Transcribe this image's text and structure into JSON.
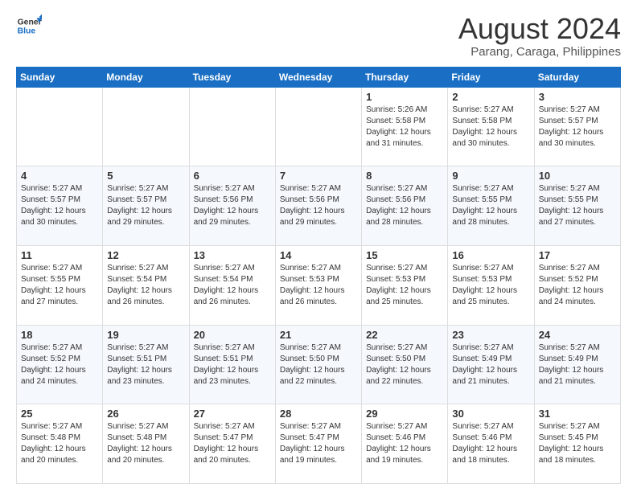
{
  "header": {
    "logo_line1": "General",
    "logo_line2": "Blue",
    "month": "August 2024",
    "location": "Parang, Caraga, Philippines"
  },
  "days_of_week": [
    "Sunday",
    "Monday",
    "Tuesday",
    "Wednesday",
    "Thursday",
    "Friday",
    "Saturday"
  ],
  "weeks": [
    [
      {
        "day": "",
        "text": ""
      },
      {
        "day": "",
        "text": ""
      },
      {
        "day": "",
        "text": ""
      },
      {
        "day": "",
        "text": ""
      },
      {
        "day": "1",
        "text": "Sunrise: 5:26 AM\nSunset: 5:58 PM\nDaylight: 12 hours\nand 31 minutes."
      },
      {
        "day": "2",
        "text": "Sunrise: 5:27 AM\nSunset: 5:58 PM\nDaylight: 12 hours\nand 30 minutes."
      },
      {
        "day": "3",
        "text": "Sunrise: 5:27 AM\nSunset: 5:57 PM\nDaylight: 12 hours\nand 30 minutes."
      }
    ],
    [
      {
        "day": "4",
        "text": "Sunrise: 5:27 AM\nSunset: 5:57 PM\nDaylight: 12 hours\nand 30 minutes."
      },
      {
        "day": "5",
        "text": "Sunrise: 5:27 AM\nSunset: 5:57 PM\nDaylight: 12 hours\nand 29 minutes."
      },
      {
        "day": "6",
        "text": "Sunrise: 5:27 AM\nSunset: 5:56 PM\nDaylight: 12 hours\nand 29 minutes."
      },
      {
        "day": "7",
        "text": "Sunrise: 5:27 AM\nSunset: 5:56 PM\nDaylight: 12 hours\nand 29 minutes."
      },
      {
        "day": "8",
        "text": "Sunrise: 5:27 AM\nSunset: 5:56 PM\nDaylight: 12 hours\nand 28 minutes."
      },
      {
        "day": "9",
        "text": "Sunrise: 5:27 AM\nSunset: 5:55 PM\nDaylight: 12 hours\nand 28 minutes."
      },
      {
        "day": "10",
        "text": "Sunrise: 5:27 AM\nSunset: 5:55 PM\nDaylight: 12 hours\nand 27 minutes."
      }
    ],
    [
      {
        "day": "11",
        "text": "Sunrise: 5:27 AM\nSunset: 5:55 PM\nDaylight: 12 hours\nand 27 minutes."
      },
      {
        "day": "12",
        "text": "Sunrise: 5:27 AM\nSunset: 5:54 PM\nDaylight: 12 hours\nand 26 minutes."
      },
      {
        "day": "13",
        "text": "Sunrise: 5:27 AM\nSunset: 5:54 PM\nDaylight: 12 hours\nand 26 minutes."
      },
      {
        "day": "14",
        "text": "Sunrise: 5:27 AM\nSunset: 5:53 PM\nDaylight: 12 hours\nand 26 minutes."
      },
      {
        "day": "15",
        "text": "Sunrise: 5:27 AM\nSunset: 5:53 PM\nDaylight: 12 hours\nand 25 minutes."
      },
      {
        "day": "16",
        "text": "Sunrise: 5:27 AM\nSunset: 5:53 PM\nDaylight: 12 hours\nand 25 minutes."
      },
      {
        "day": "17",
        "text": "Sunrise: 5:27 AM\nSunset: 5:52 PM\nDaylight: 12 hours\nand 24 minutes."
      }
    ],
    [
      {
        "day": "18",
        "text": "Sunrise: 5:27 AM\nSunset: 5:52 PM\nDaylight: 12 hours\nand 24 minutes."
      },
      {
        "day": "19",
        "text": "Sunrise: 5:27 AM\nSunset: 5:51 PM\nDaylight: 12 hours\nand 23 minutes."
      },
      {
        "day": "20",
        "text": "Sunrise: 5:27 AM\nSunset: 5:51 PM\nDaylight: 12 hours\nand 23 minutes."
      },
      {
        "day": "21",
        "text": "Sunrise: 5:27 AM\nSunset: 5:50 PM\nDaylight: 12 hours\nand 22 minutes."
      },
      {
        "day": "22",
        "text": "Sunrise: 5:27 AM\nSunset: 5:50 PM\nDaylight: 12 hours\nand 22 minutes."
      },
      {
        "day": "23",
        "text": "Sunrise: 5:27 AM\nSunset: 5:49 PM\nDaylight: 12 hours\nand 21 minutes."
      },
      {
        "day": "24",
        "text": "Sunrise: 5:27 AM\nSunset: 5:49 PM\nDaylight: 12 hours\nand 21 minutes."
      }
    ],
    [
      {
        "day": "25",
        "text": "Sunrise: 5:27 AM\nSunset: 5:48 PM\nDaylight: 12 hours\nand 20 minutes."
      },
      {
        "day": "26",
        "text": "Sunrise: 5:27 AM\nSunset: 5:48 PM\nDaylight: 12 hours\nand 20 minutes."
      },
      {
        "day": "27",
        "text": "Sunrise: 5:27 AM\nSunset: 5:47 PM\nDaylight: 12 hours\nand 20 minutes."
      },
      {
        "day": "28",
        "text": "Sunrise: 5:27 AM\nSunset: 5:47 PM\nDaylight: 12 hours\nand 19 minutes."
      },
      {
        "day": "29",
        "text": "Sunrise: 5:27 AM\nSunset: 5:46 PM\nDaylight: 12 hours\nand 19 minutes."
      },
      {
        "day": "30",
        "text": "Sunrise: 5:27 AM\nSunset: 5:46 PM\nDaylight: 12 hours\nand 18 minutes."
      },
      {
        "day": "31",
        "text": "Sunrise: 5:27 AM\nSunset: 5:45 PM\nDaylight: 12 hours\nand 18 minutes."
      }
    ]
  ]
}
